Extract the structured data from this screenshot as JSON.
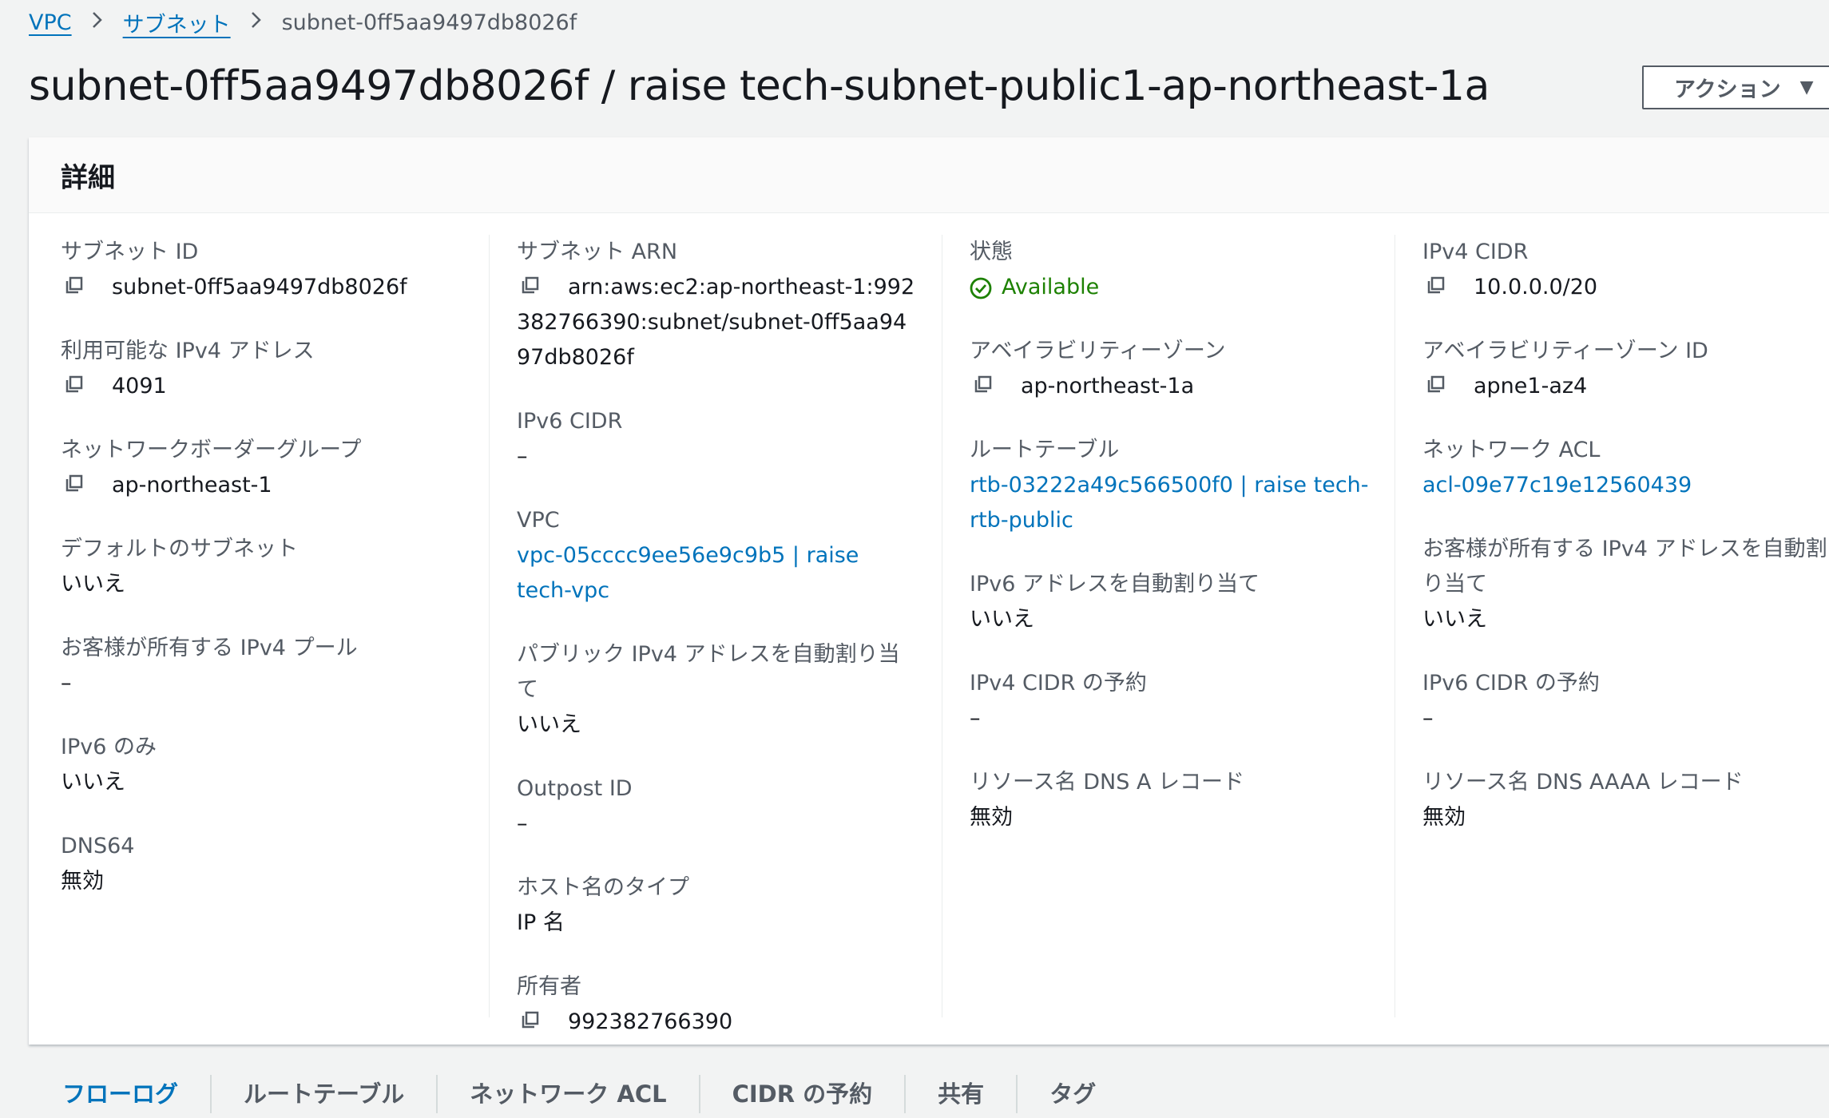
{
  "breadcrumb": {
    "items": [
      "VPC",
      "サブネット",
      "subnet-0ff5aa9497db8026f"
    ]
  },
  "page": {
    "title": "subnet-0ff5aa9497db8026f / raise tech-subnet-public1-ap-northeast-1a",
    "action_label": "アクション"
  },
  "details": {
    "header": "詳細",
    "col1": {
      "subnet_id_label": "サブネット ID",
      "subnet_id": "subnet-0ff5aa9497db8026f",
      "available_ipv4_label": "利用可能な IPv4 アドレス",
      "available_ipv4": "4091",
      "nbg_label": "ネットワークボーダーグループ",
      "nbg": "ap-northeast-1",
      "default_subnet_label": "デフォルトのサブネット",
      "default_subnet": "いいえ",
      "customer_pool_label": "お客様が所有する IPv4 プール",
      "customer_pool": "–",
      "ipv6_only_label": "IPv6 のみ",
      "ipv6_only": "いいえ",
      "dns64_label": "DNS64",
      "dns64": "無効"
    },
    "col2": {
      "arn_label": "サブネット ARN",
      "arn": "arn:aws:ec2:ap-northeast-1:992382766390:subnet/subnet-0ff5aa9497db8026f",
      "ipv6_cidr_label": "IPv6 CIDR",
      "ipv6_cidr": "–",
      "vpc_label": "VPC",
      "vpc": "vpc-05cccc9ee56e9c9b5 | raise tech-vpc",
      "auto_public_ipv4_label": "パブリック IPv4 アドレスを自動割り当て",
      "auto_public_ipv4": "いいえ",
      "outpost_label": "Outpost ID",
      "outpost": "–",
      "hostname_type_label": "ホスト名のタイプ",
      "hostname_type": "IP 名",
      "owner_label": "所有者",
      "owner": "992382766390"
    },
    "col3": {
      "state_label": "状態",
      "state": "Available",
      "az_label": "アベイラビリティーゾーン",
      "az": "ap-northeast-1a",
      "route_table_label": "ルートテーブル",
      "route_table": "rtb-03222a49c566500f0 | raise tech-rtb-public",
      "auto_ipv6_label": "IPv6 アドレスを自動割り当て",
      "auto_ipv6": "いいえ",
      "ipv4_reservation_label": "IPv4 CIDR の予約",
      "ipv4_reservation": "–",
      "dns_a_label": "リソース名 DNS A レコード",
      "dns_a": "無効"
    },
    "col4": {
      "ipv4_cidr_label": "IPv4 CIDR",
      "ipv4_cidr": "10.0.0.0/20",
      "az_id_label": "アベイラビリティーゾーン ID",
      "az_id": "apne1-az4",
      "acl_label": "ネットワーク ACL",
      "acl": "acl-09e77c19e12560439",
      "customer_ipv4_label": "お客様が所有する IPv4 アドレスを自動割り当て",
      "customer_ipv4": "いいえ",
      "ipv6_reservation_label": "IPv6 CIDR の予約",
      "ipv6_reservation": "–",
      "dns_aaaa_label": "リソース名 DNS AAAA レコード",
      "dns_aaaa": "無効"
    }
  },
  "tabs": [
    "フローログ",
    "ルートテーブル",
    "ネットワーク ACL",
    "CIDR の予約",
    "共有",
    "タグ"
  ],
  "colors": {
    "link": "#0073bb",
    "status_available": "#1d8102",
    "text": "#16191f",
    "label": "#545b64"
  }
}
